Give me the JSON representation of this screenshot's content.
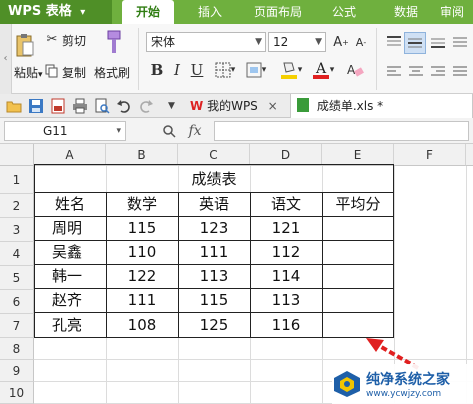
{
  "app": {
    "title": "WPS 表格",
    "menu_arrow": "▾"
  },
  "menu_tabs": [
    {
      "label": "开始",
      "active": true
    },
    {
      "label": "插入",
      "active": false
    },
    {
      "label": "页面布局",
      "active": false
    },
    {
      "label": "公式",
      "active": false
    },
    {
      "label": "数据",
      "active": false
    },
    {
      "label": "审阅",
      "active": false
    }
  ],
  "ribbon": {
    "grip": "‹",
    "cut": "剪切",
    "copy": "复制",
    "format_painter": "格式刷",
    "paste_icon_label": "粘贴",
    "font_name": "宋体",
    "font_size": "12"
  },
  "quickbar": {
    "tabs": [
      {
        "label": "我的WPS",
        "close": "×"
      },
      {
        "label": "成绩单.xls *",
        "close": ""
      }
    ]
  },
  "formula_bar": {
    "cell_ref": "G11",
    "fx": "fx",
    "value": ""
  },
  "columns": [
    "A",
    "B",
    "C",
    "D",
    "E",
    "F"
  ],
  "rows": [
    "1",
    "2",
    "3",
    "4",
    "5",
    "6",
    "7",
    "8",
    "9",
    "10"
  ],
  "sheet": {
    "title": "成绩表",
    "headers": [
      "姓名",
      "数学",
      "英语",
      "语文",
      "平均分"
    ],
    "records": [
      [
        "周明",
        "115",
        "123",
        "121",
        ""
      ],
      [
        "吴鑫",
        "110",
        "111",
        "112",
        ""
      ],
      [
        "韩一",
        "122",
        "113",
        "114",
        ""
      ],
      [
        "赵齐",
        "111",
        "115",
        "113",
        ""
      ],
      [
        "孔亮",
        "108",
        "125",
        "116",
        ""
      ]
    ]
  },
  "watermark": {
    "text": "纯净系统之家",
    "sub": "www.ycwjzy.com"
  },
  "colors": {
    "menu_green": "#6fb03e",
    "selection_green": "#1a7f1a",
    "arrow_red": "#e02020"
  }
}
